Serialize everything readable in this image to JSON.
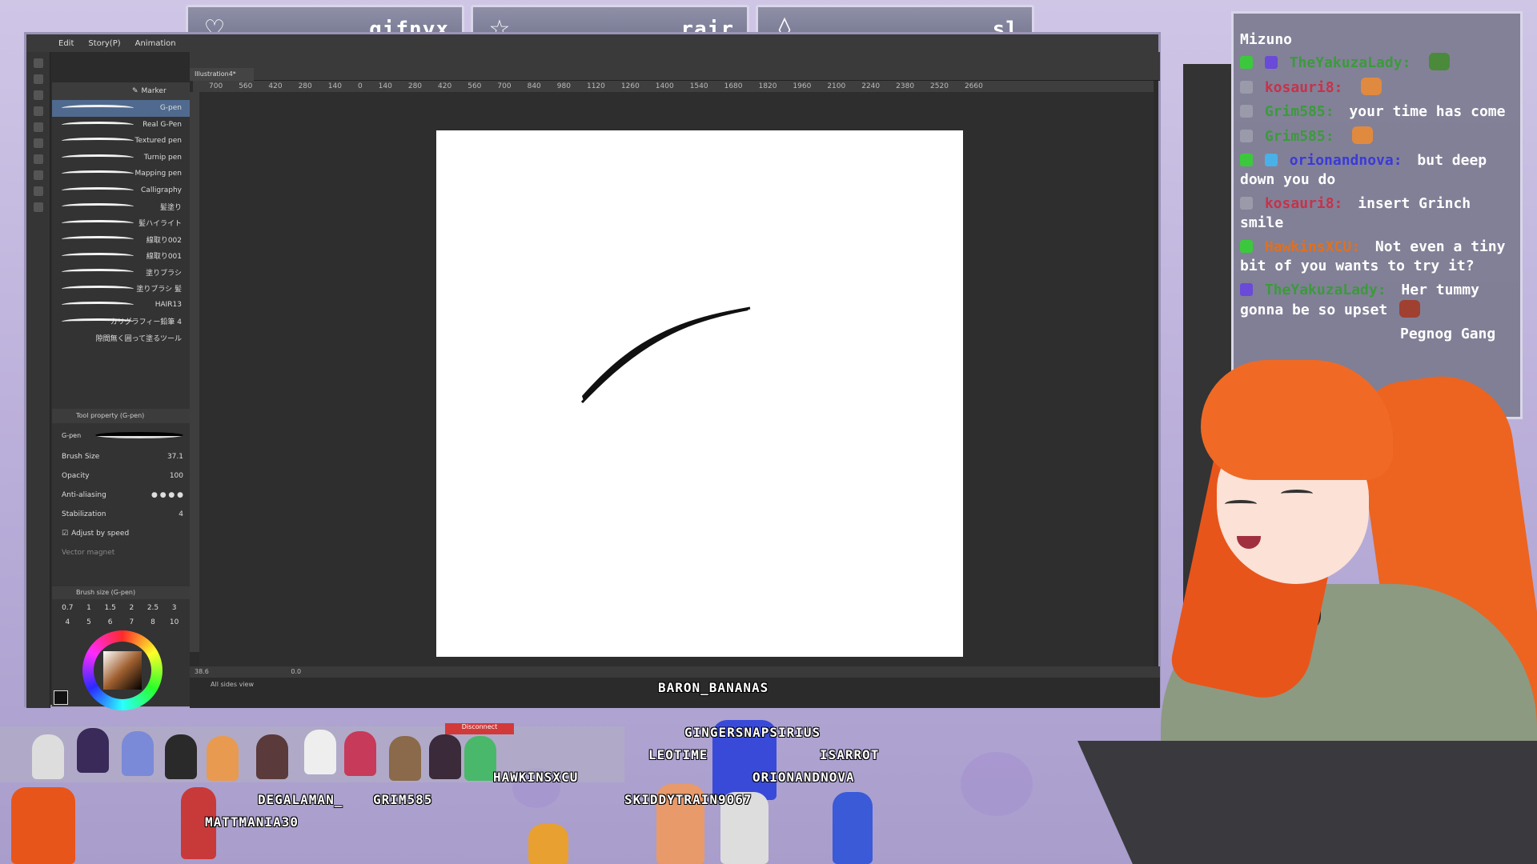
{
  "banners": [
    {
      "icon": "heart",
      "name": "gifnyx"
    },
    {
      "icon": "star",
      "name": "rair"
    },
    {
      "icon": "diamond",
      "name": "sl"
    }
  ],
  "app": {
    "menu": [
      "Edit",
      "Story(P)",
      "Animation"
    ],
    "subtool_group": "Marker",
    "doc_tab": "Illustration4*",
    "brushes": [
      "G-pen",
      "Real G-Pen",
      "Textured pen",
      "Turnip pen",
      "Mapping pen",
      "Calligraphy",
      "髪塗り",
      "髪ハイライト",
      "線取り002",
      "線取り001",
      "塗りブラシ",
      "塗りブラシ 髪",
      "HAIR13",
      "カリグラフィー鉛筆 4",
      "隙間無く囲って塗るツール"
    ],
    "selected_brush": "G-pen",
    "ruler_ticks": [
      "700",
      "560",
      "420",
      "280",
      "140",
      "0",
      "140",
      "280",
      "420",
      "560",
      "700",
      "840",
      "980",
      "1120",
      "1260",
      "1400",
      "1540",
      "1680",
      "1820",
      "1960",
      "2100",
      "2240",
      "2380",
      "2520",
      "2660"
    ],
    "tool_property": {
      "header": "Tool property (G-pen)",
      "preset": "G-pen",
      "brush_size_label": "Brush Size",
      "brush_size_value": "37.1",
      "opacity_label": "Opacity",
      "opacity_value": "100",
      "antialias_label": "Anti-aliasing",
      "stabilization_label": "Stabilization",
      "stabilization_value": "4",
      "adjust_label": "Adjust by speed",
      "vector_label": "Vector magnet"
    },
    "brush_size_header": "Brush size (G-pen)",
    "brush_sizes": [
      "0.7",
      "1",
      "1.5",
      "2",
      "2.5",
      "3",
      "4",
      "5",
      "6",
      "7",
      "8",
      "10"
    ],
    "zoom": "38.6",
    "rotation": "0.0",
    "layer_strip_label": "All sides view"
  },
  "chat": {
    "title": "Mizuno",
    "messages": [
      {
        "user": "TheYakuzaLady:",
        "text": "",
        "color": "#3c9a3c"
      },
      {
        "user": "kosauri8:",
        "text": "",
        "color": "#c8324a"
      },
      {
        "user": "Grim585:",
        "text": "your time has come",
        "color": "#3c9a3c"
      },
      {
        "user": "Grim585:",
        "text": "",
        "color": "#3c9a3c"
      },
      {
        "user": "orionandnova:",
        "text": "but deep down you do",
        "color": "#3a3ad8"
      },
      {
        "user": "kosauri8:",
        "text": "insert Grinch smile",
        "color": "#c8324a"
      },
      {
        "user": "HawkinsXCU:",
        "text": "Not even a tiny bit of you wants to try it?",
        "color": "#e07020"
      },
      {
        "user": "TheYakuzaLady:",
        "text": "Her tummy gonna be so upset",
        "color": "#3c9a3c"
      },
      {
        "user": "",
        "text": "Pegnog Gang",
        "color": "#3c9a3c"
      }
    ]
  },
  "viewers": {
    "disconnect_label": "Disconnect",
    "names": [
      "BARON_BANANAS",
      "GINGERSNAPSIRIUS",
      "LEOTIME",
      "ISARROT",
      "HAWKINSXCU",
      "ORIONANDNOVA",
      "DEGALAMAN_",
      "GRIM585",
      "SKIDDYTRAIN9067",
      "MATTMANIA30"
    ]
  },
  "colors": {
    "accent": "#4f6a8e",
    "chat_bg": "#787890",
    "hair": "#ec6420"
  }
}
